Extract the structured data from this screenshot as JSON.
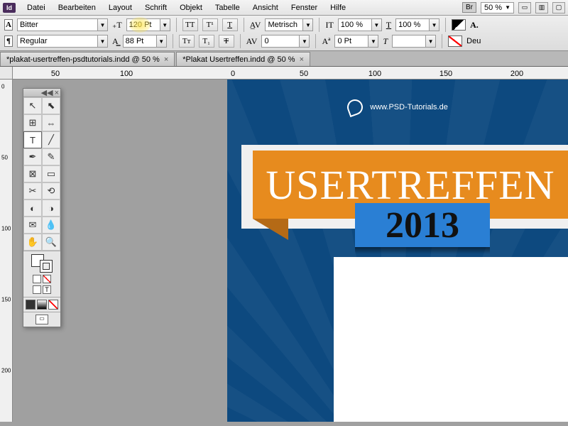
{
  "app": {
    "id_label": "Id"
  },
  "menu": {
    "items": [
      "Datei",
      "Bearbeiten",
      "Layout",
      "Schrift",
      "Objekt",
      "Tabelle",
      "Ansicht",
      "Fenster",
      "Hilfe"
    ],
    "br": "Br",
    "zoom": "50 %"
  },
  "control": {
    "font_family": "Bitter",
    "font_style": "Regular",
    "font_size": "120 Pt",
    "leading": "88 Pt",
    "kerning": "Metrisch",
    "tracking": "0",
    "vscale": "100 %",
    "hscale": "100 %",
    "baseline": "0 Pt",
    "language": "Deu"
  },
  "tabs": [
    {
      "label": "*plakat-usertreffen-psdtutorials.indd @ 50 %"
    },
    {
      "label": "*Plakat Usertreffen.indd @ 50 %"
    }
  ],
  "ruler_h": [
    "50",
    "100",
    "0",
    "50",
    "100",
    "150",
    "200"
  ],
  "ruler_v": [
    "0",
    "50",
    "100",
    "150",
    "200"
  ],
  "poster": {
    "url": "www.PSD-Tutorials.de",
    "title": "USERTREFFEN",
    "year": "2013"
  }
}
